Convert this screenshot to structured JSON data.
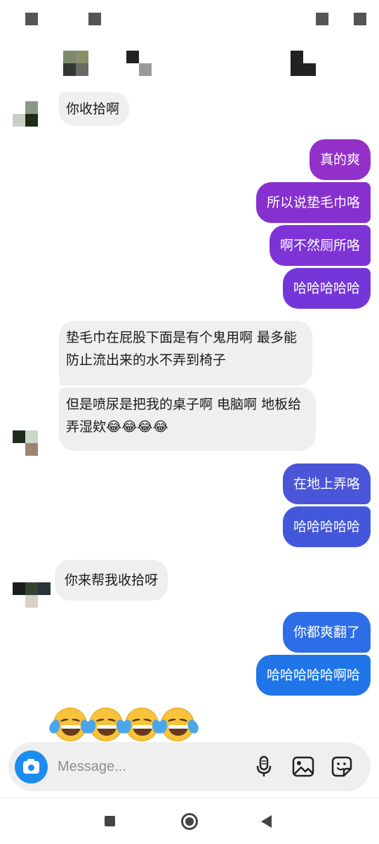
{
  "conversation": {
    "messages": [
      {
        "side": "in",
        "text": "你收拾啊"
      },
      {
        "side": "out",
        "text": "真的爽",
        "color": "#9330c9"
      },
      {
        "side": "out",
        "text": "所以说垫毛巾咯",
        "color": "#8730d0"
      },
      {
        "side": "out",
        "text": "啊不然厕所咯",
        "color": "#7e33d6"
      },
      {
        "side": "out",
        "text": "哈哈哈哈哈",
        "color": "#7436d9"
      },
      {
        "side": "in",
        "text": "垫毛巾在屁股下面是有个鬼用啊 最多能防止流出来的水不弄到椅子"
      },
      {
        "side": "in",
        "text": "但是喷尿是把我的桌子啊 电脑啊 地板给弄湿欸😂😂😂😂"
      },
      {
        "side": "out",
        "text": "在地上弄咯",
        "color": "#4a55d8"
      },
      {
        "side": "out",
        "text": "哈哈哈哈哈",
        "color": "#4257db"
      },
      {
        "side": "in",
        "text": "你来帮我收拾呀"
      },
      {
        "side": "out",
        "text": "你都爽翻了",
        "color": "#2d6ee6"
      },
      {
        "side": "out",
        "text": "哈哈哈哈哈啊哈",
        "color": "#2076e8"
      }
    ],
    "last_emoji_message": "😂😂😂😂"
  },
  "composer": {
    "placeholder": "Message...",
    "icons": [
      "camera-icon",
      "microphone-icon",
      "gallery-icon",
      "sticker-icon"
    ],
    "accent": "#1d8cf0"
  },
  "navbar": {
    "icons": [
      "recents-icon",
      "home-icon",
      "back-icon"
    ]
  }
}
